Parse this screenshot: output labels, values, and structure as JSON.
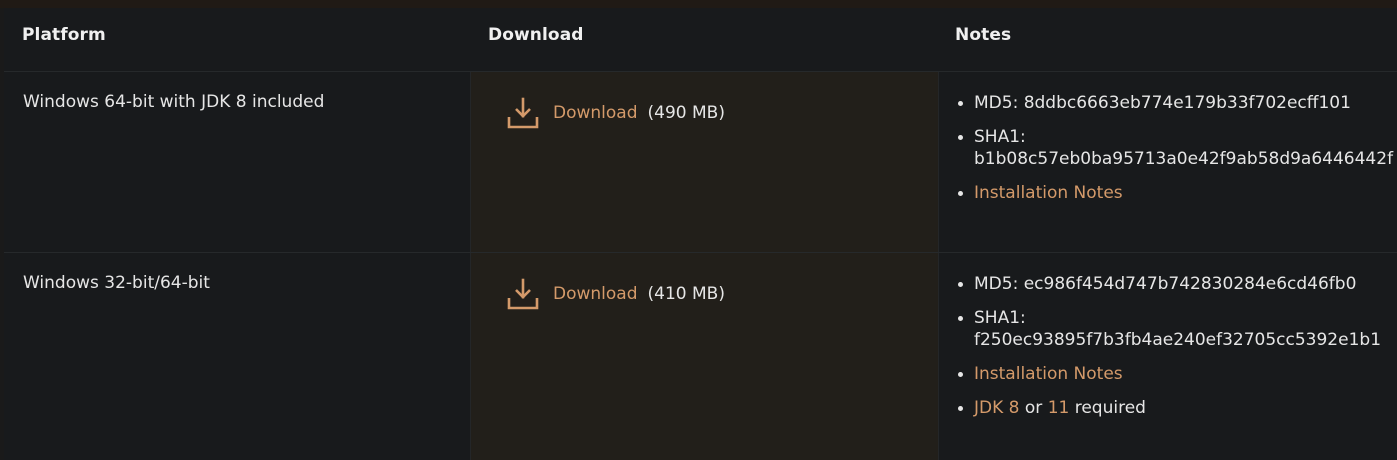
{
  "header": {
    "platform": "Platform",
    "download": "Download",
    "notes": "Notes"
  },
  "rows": [
    {
      "platform": "Windows 64-bit with JDK 8 included",
      "download_label": "Download",
      "size": "(490 MB)",
      "md5": "MD5: 8ddbc6663eb774e179b33f702ecff101",
      "sha1_label": "SHA1:",
      "sha1": "b1b08c57eb0ba95713a0e42f9ab58d9a6446442f",
      "install_notes": "Installation Notes"
    },
    {
      "platform": "Windows 32-bit/64-bit",
      "download_label": "Download",
      "size": "(410 MB)",
      "md5": "MD5: ec986f454d747b742830284e6cd46fb0",
      "sha1_label": "SHA1:",
      "sha1": "f250ec93895f7b3fb4ae240ef32705cc5392e1b1",
      "install_notes": "Installation Notes",
      "jdk8": "JDK 8",
      "or": "or",
      "jdk11": "11",
      "required": "required"
    }
  ],
  "colors": {
    "accent": "#d49a6a",
    "background": "#181a1c",
    "download_column": "#221f1a"
  },
  "icons": {
    "download": "download-icon"
  }
}
